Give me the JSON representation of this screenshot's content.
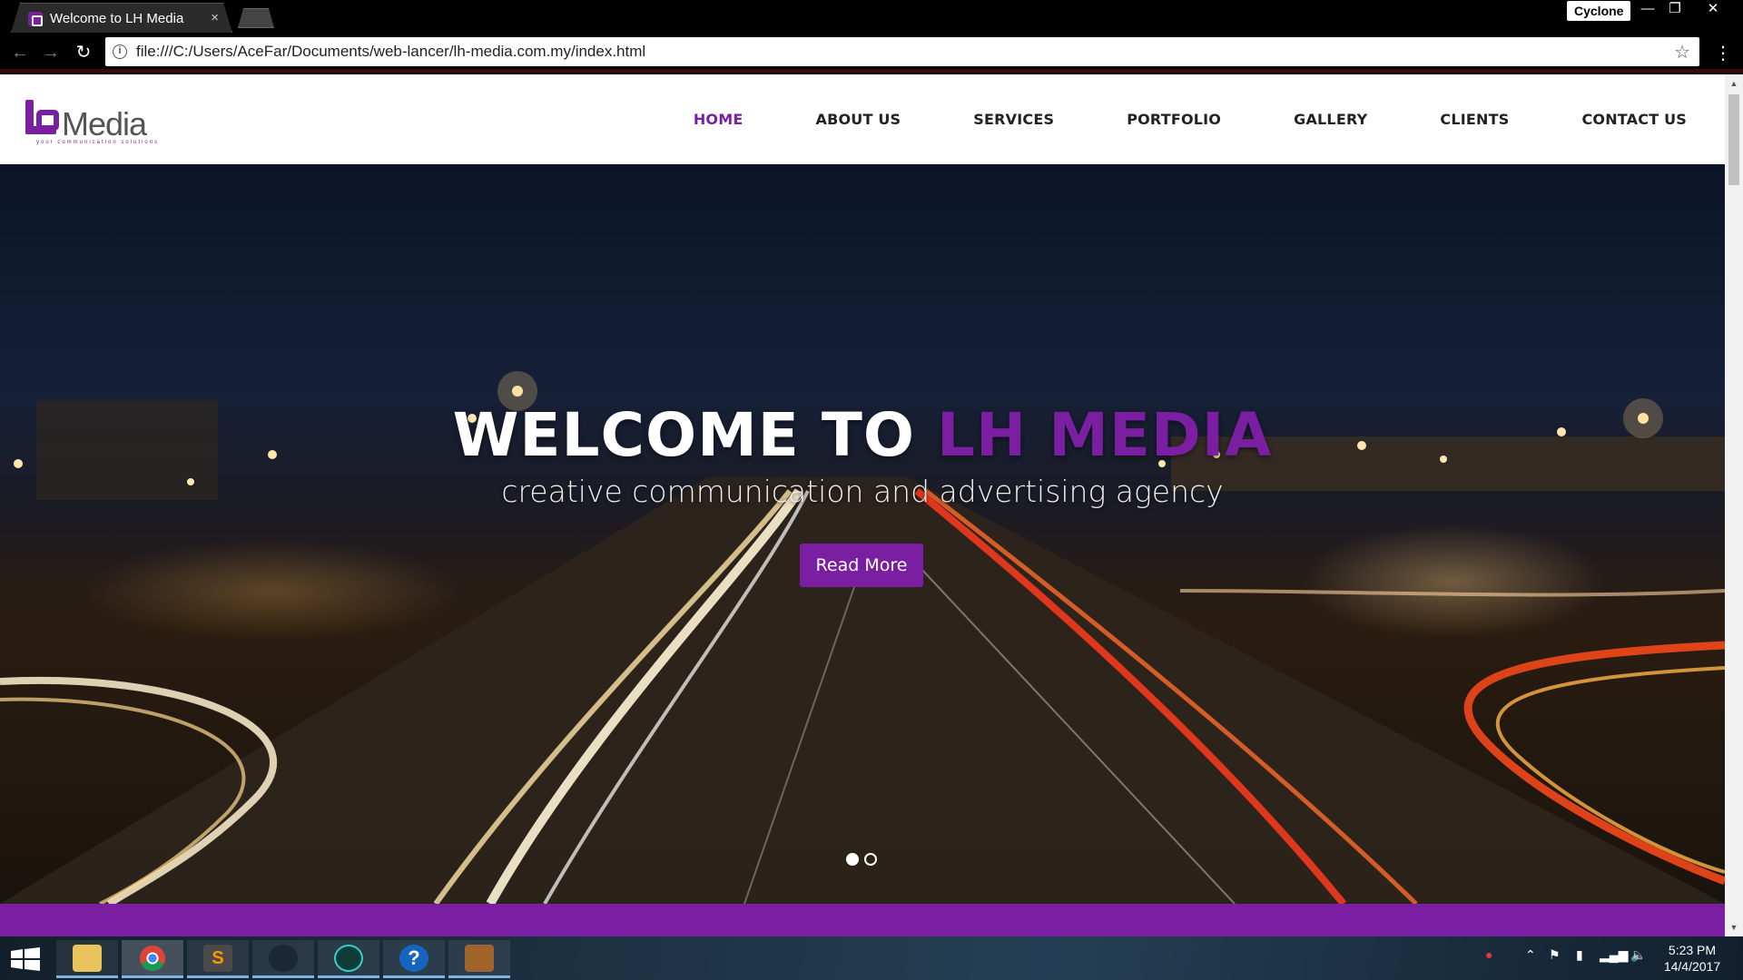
{
  "browser": {
    "tab_title": "Welcome to LH Media",
    "tab_close": "×",
    "profile_name": "Cyclone",
    "url": "file:///C:/Users/AceFar/Documents/web-lancer/lh-media.com.my/index.html",
    "controls": {
      "minimize": "—",
      "restore": "❐",
      "close": "✕"
    },
    "nav": {
      "back": "←",
      "forward": "→",
      "reload": "↻",
      "info": "i",
      "star": "☆",
      "menu": "⋮"
    }
  },
  "site": {
    "logo_word": "Media",
    "logo_tagline": "your communication solutions",
    "nav": [
      {
        "label": "HOME",
        "active": true
      },
      {
        "label": "ABOUT US",
        "active": false
      },
      {
        "label": "SERVICES",
        "active": false
      },
      {
        "label": "PORTFOLIO",
        "active": false
      },
      {
        "label": "GALLERY",
        "active": false
      },
      {
        "label": "CLIENTS",
        "active": false
      },
      {
        "label": "CONTACT US",
        "active": false
      }
    ],
    "hero": {
      "title_prefix": "WELCOME TO",
      "title_brand": "LH MEDIA",
      "subtitle": "creative communication and advertising agency",
      "button": "Read More",
      "slides": 2,
      "active_slide": 1
    },
    "accent_color": "#7b1fa2"
  },
  "taskbar": {
    "apps": [
      "file-explorer",
      "chrome",
      "sublime-text",
      "steam",
      "app-5",
      "help",
      "archive"
    ],
    "time": "5:23 PM",
    "date": "14/4/2017"
  }
}
